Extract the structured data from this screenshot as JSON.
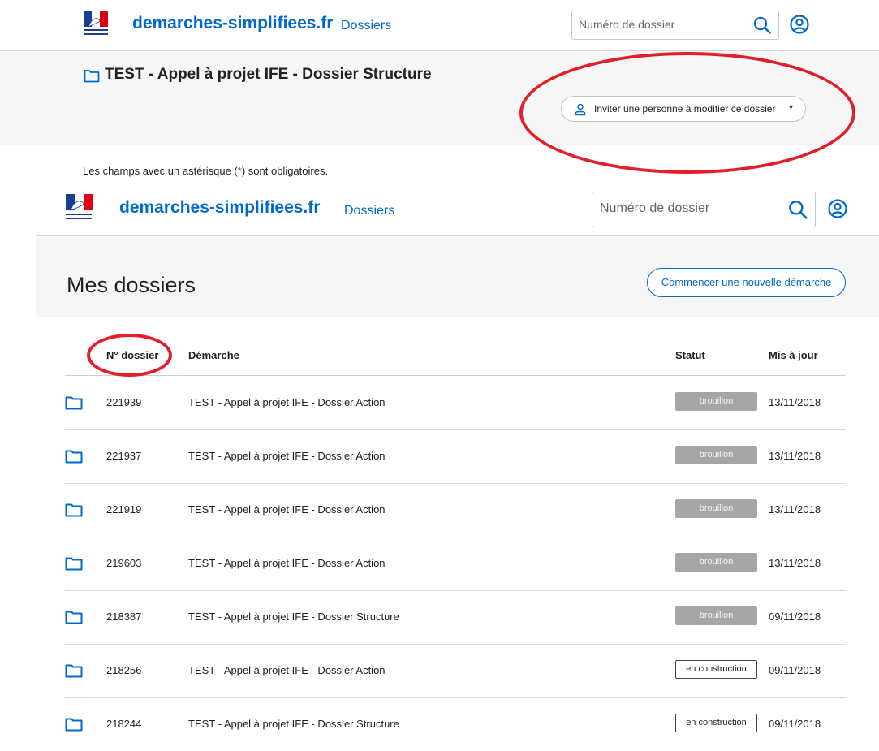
{
  "header1": {
    "brand": "demarches-simplifiees.fr",
    "nav_dossiers": "Dossiers",
    "search_placeholder": "Numéro de dossier",
    "icons": [
      "marianne-logo",
      "search-icon",
      "user-icon"
    ],
    "accent_color": "#0069cc"
  },
  "dossier": {
    "title": "TEST - Appel à projet IFE - Dossier Structure",
    "invite_label": "Inviter une personne à modifier ce dossier",
    "invite_caret": "▾"
  },
  "mandatory": {
    "before": "Les champs avec un astérisque (",
    "asterisk": "*",
    "after": ") sont obligatoires."
  },
  "header2": {
    "brand": "demarches-simplifiees.fr",
    "nav_dossiers": "Dossiers",
    "search_placeholder": "Numéro de dossier"
  },
  "main": {
    "title": "Mes dossiers",
    "new_button": "Commencer une nouvelle démarche"
  },
  "table": {
    "headers": {
      "num": "N° dossier",
      "demarche": "Démarche",
      "statut": "Statut",
      "maj": "Mis à jour"
    },
    "rows": [
      {
        "num": "221939",
        "demarche": "TEST - Appel à projet IFE - Dossier Action",
        "statut": "brouillon",
        "date": "13/11/2018"
      },
      {
        "num": "221937",
        "demarche": "TEST - Appel à projet IFE - Dossier Action",
        "statut": "brouillon",
        "date": "13/11/2018"
      },
      {
        "num": "221919",
        "demarche": "TEST - Appel à projet IFE - Dossier Action",
        "statut": "brouillon",
        "date": "13/11/2018"
      },
      {
        "num": "219603",
        "demarche": "TEST - Appel à projet IFE - Dossier Action",
        "statut": "brouillon",
        "date": "13/11/2018"
      },
      {
        "num": "218387",
        "demarche": "TEST - Appel à projet IFE - Dossier Structure",
        "statut": "brouillon",
        "date": "09/11/2018"
      },
      {
        "num": "218256",
        "demarche": "TEST - Appel à projet IFE - Dossier Action",
        "statut": "en construction",
        "date": "09/11/2018"
      },
      {
        "num": "218244",
        "demarche": "TEST - Appel à projet IFE - Dossier Structure",
        "statut": "en construction",
        "date": "09/11/2018"
      }
    ]
  },
  "annotation_color": "#e01f2a"
}
